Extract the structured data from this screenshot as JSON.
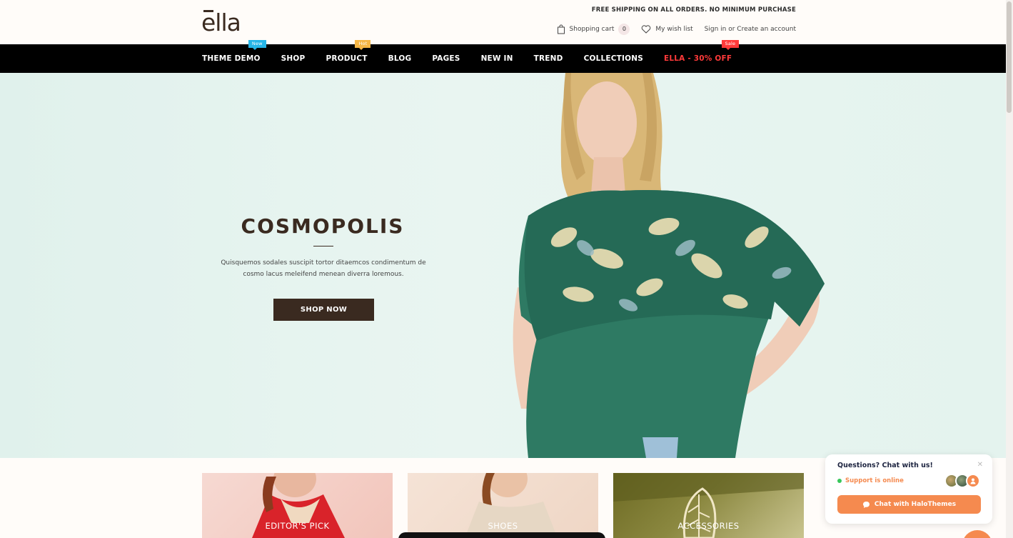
{
  "header": {
    "logo": "ella",
    "promo": "FREE SHIPPING ON ALL ORDERS. NO MINIMUM PURCHASE",
    "cart_label": "Shopping cart",
    "cart_count": "0",
    "wishlist_label": "My wish list",
    "account_label": "Sign in or Create an account"
  },
  "nav": {
    "items": [
      {
        "label": "THEME DEMO",
        "badge": "New"
      },
      {
        "label": "SHOP"
      },
      {
        "label": "PRODUCT",
        "badge": "Hot"
      },
      {
        "label": "BLOG"
      },
      {
        "label": "PAGES"
      },
      {
        "label": "NEW IN"
      },
      {
        "label": "TREND"
      },
      {
        "label": "COLLECTIONS"
      },
      {
        "label": "ELLA - 30% OFF",
        "badge": "Sale"
      }
    ]
  },
  "hero": {
    "title": "COSMOPOLIS",
    "text": "Quisquemos sodales suscipit tortor ditaemcos condimentum de cosmo lacus meleifend menean diverra loremous.",
    "button": "SHOP NOW"
  },
  "categories": [
    {
      "label": "EDITOR'S PICK"
    },
    {
      "label": "SHOES"
    },
    {
      "label": "ACCESSORIES"
    }
  ],
  "chat": {
    "title": "Questions? Chat with us!",
    "status": "Support is online",
    "button": "Chat with HaloThemes"
  },
  "colors": {
    "brand": "#3a2a20",
    "nav_bg": "#000000",
    "sale": "#ff3a3a",
    "chat_accent": "#f58a4f",
    "online": "#37c75b"
  }
}
